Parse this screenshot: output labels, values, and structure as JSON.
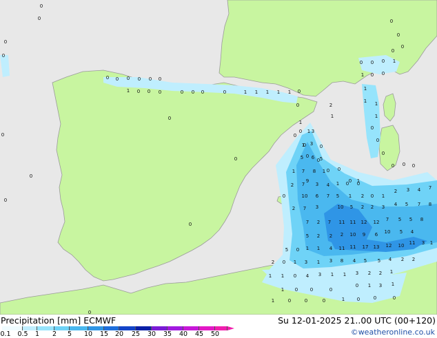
{
  "title": {
    "label": "Precipitation [mm]",
    "model": "ECMWF"
  },
  "run": "Su 12-01-2025 21..00 UTC (00+120)",
  "credit": "©weatheronline.co.uk",
  "colors": {
    "sea": "#e8e8e8",
    "land": "#c8f5a0",
    "coast": "#9a9a9a"
  },
  "legend": {
    "ticks": [
      "0.1",
      "0.5",
      "1",
      "2",
      "5",
      "10",
      "15",
      "20",
      "25",
      "30",
      "35",
      "40",
      "45",
      "50"
    ],
    "swatches": [
      "#f0fcff",
      "#bfeefe",
      "#96e4fc",
      "#6fd3f7",
      "#4ab8ef",
      "#2f95e6",
      "#1e6fdc",
      "#1344c8",
      "#0a20a6",
      "#7a1ad6",
      "#a219e0",
      "#c718d8",
      "#e318c6",
      "#f11fae"
    ]
  },
  "map_values": [
    "0",
    "0",
    "0",
    "0",
    "0",
    "0",
    "0",
    "0",
    "0",
    "0",
    "0",
    "0",
    "0",
    "1",
    "0",
    "0",
    "0",
    "0",
    "0",
    "0",
    "0",
    "1",
    "1",
    "1",
    "1",
    "1",
    "0",
    "0",
    "0",
    "0",
    "0",
    "0",
    "0",
    "0",
    "0",
    "0",
    "0",
    "0",
    "0",
    "1",
    "1",
    "0",
    "0",
    "1",
    "1",
    "1",
    "2",
    "1",
    "1",
    "0",
    "0",
    "0",
    "1",
    "1",
    "0",
    "0",
    "0",
    "0",
    "0",
    "0",
    "0",
    "0",
    "3",
    "1",
    "3",
    "0",
    "5",
    "6",
    "5",
    "0",
    "0",
    "1",
    "7",
    "8",
    "1",
    "9",
    "0",
    "1",
    "2",
    "7",
    "3",
    "4",
    "1",
    "0",
    "0",
    "0",
    "10",
    "6",
    "7",
    "5",
    "1",
    "2",
    "0",
    "1",
    "2",
    "3",
    "4",
    "7",
    "2",
    "7",
    "3",
    "10",
    "5",
    "2",
    "2",
    "3",
    "4",
    "5",
    "7",
    "8",
    "7",
    "2",
    "7",
    "11",
    "11",
    "12",
    "12",
    "7",
    "5",
    "5",
    "8",
    "5",
    "2",
    "2",
    "2",
    "10",
    "9",
    "6",
    "10",
    "5",
    "4",
    "5",
    "0",
    "1",
    "1",
    "4",
    "11",
    "11",
    "17",
    "13",
    "12",
    "10",
    "11",
    "3",
    "1",
    "2",
    "0",
    "1",
    "3",
    "1",
    "3",
    "8",
    "4",
    "5",
    "5",
    "4",
    "2",
    "2",
    "1",
    "1",
    "0",
    "4",
    "3",
    "1",
    "1",
    "3",
    "2",
    "2",
    "1",
    "1",
    "0",
    "0",
    "0",
    "0",
    "1",
    "3",
    "1",
    "1",
    "0",
    "0",
    "0",
    "1",
    "0",
    "0",
    "0",
    "0"
  ]
}
